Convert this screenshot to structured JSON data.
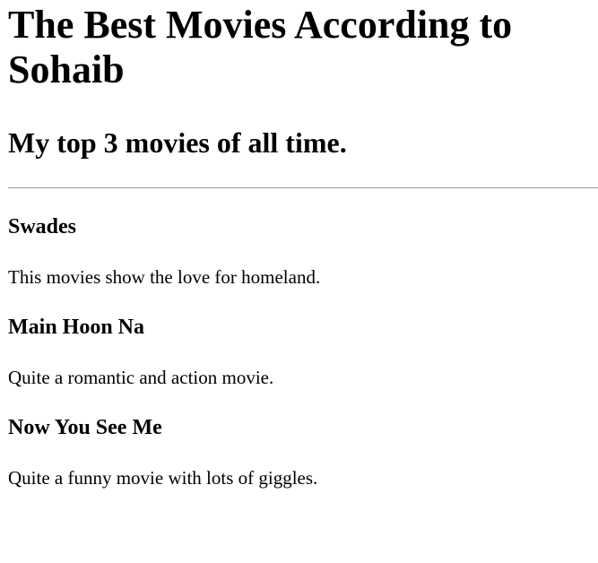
{
  "page": {
    "title": "The Best Movies According to Sohaib",
    "subtitle": "My top 3 movies of all time."
  },
  "movies": [
    {
      "title": "Swades",
      "description": "This movies show the love for homeland."
    },
    {
      "title": "Main Hoon Na",
      "description": "Quite a romantic and action movie."
    },
    {
      "title": "Now You See Me",
      "description": "Quite a funny movie with lots of giggles."
    }
  ]
}
